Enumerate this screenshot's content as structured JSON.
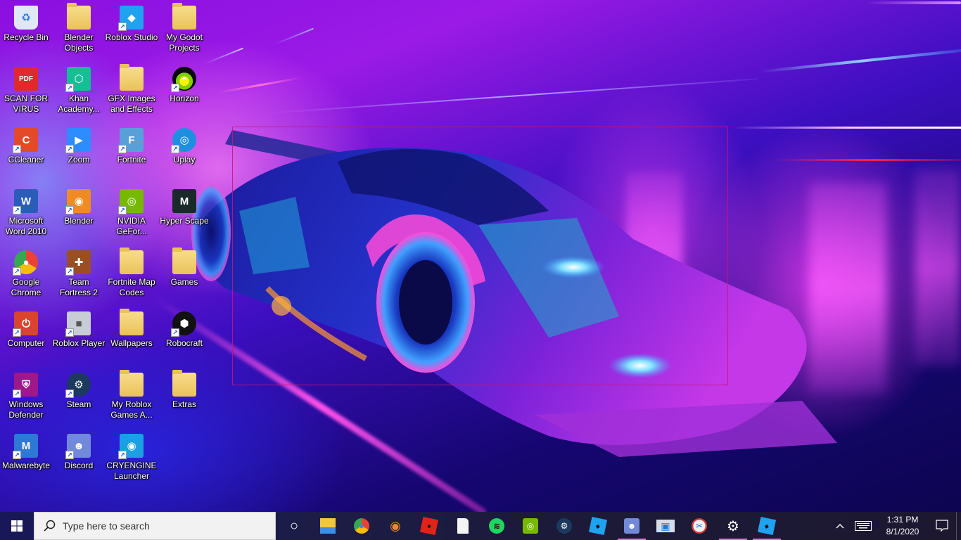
{
  "desktop": {
    "wallpaper": "neon sports car racing wallpaper",
    "selection_rect_color": "#c81478",
    "icons": [
      {
        "label": "Recycle Bin",
        "icon": "recycle-bin-icon",
        "shortcut": false,
        "color": "#dfe8f5"
      },
      {
        "label": "SCAN FOR VIRUS",
        "icon": "pdf-icon",
        "shortcut": false,
        "color": "#e02a2a"
      },
      {
        "label": "CCleaner",
        "icon": "ccleaner-icon",
        "shortcut": true,
        "color": "#e24a2a"
      },
      {
        "label": "Microsoft Word 2010",
        "icon": "word-icon",
        "shortcut": true,
        "color": "#2b5cb8"
      },
      {
        "label": "Google Chrome",
        "icon": "chrome-icon",
        "shortcut": true,
        "color": "#4285f4"
      },
      {
        "label": "Computer",
        "icon": "power-icon",
        "shortcut": true,
        "color": "#d9442f"
      },
      {
        "label": "Windows Defender",
        "icon": "defender-shield-icon",
        "shortcut": true,
        "color": "#a0178a"
      },
      {
        "label": "Malwarebyte",
        "icon": "malwarebytes-icon",
        "shortcut": true,
        "color": "#2f78d6"
      },
      {
        "label": "Blender Objects",
        "icon": "folder-icon",
        "shortcut": false,
        "color": "#eac25a"
      },
      {
        "label": "Khan Academy...",
        "icon": "khan-academy-icon",
        "shortcut": true,
        "color": "#14bf96"
      },
      {
        "label": "Zoom",
        "icon": "zoom-icon",
        "shortcut": true,
        "color": "#2d8cff"
      },
      {
        "label": "Blender",
        "icon": "blender-icon",
        "shortcut": true,
        "color": "#f08a24"
      },
      {
        "label": "Team Fortress 2",
        "icon": "tf2-icon",
        "shortcut": true,
        "color": "#9a4e22"
      },
      {
        "label": "Roblox Player",
        "icon": "roblox-icon",
        "shortcut": true,
        "color": "#c8ccd4"
      },
      {
        "label": "Steam",
        "icon": "steam-icon",
        "shortcut": true,
        "color": "#1b3a5e"
      },
      {
        "label": "Discord",
        "icon": "discord-icon",
        "shortcut": true,
        "color": "#7289da"
      },
      {
        "label": "Roblox Studio",
        "icon": "roblox-studio-icon",
        "shortcut": true,
        "color": "#1fa3f0"
      },
      {
        "label": "GFX Images and Effects",
        "icon": "folder-icon",
        "shortcut": false,
        "color": "#eac25a"
      },
      {
        "label": "Fortnite",
        "icon": "fortnite-icon",
        "shortcut": true,
        "color": "#5aa0d8"
      },
      {
        "label": "NVIDIA GeFor...",
        "icon": "nvidia-icon",
        "shortcut": true,
        "color": "#76b900"
      },
      {
        "label": "Fortnite Map Codes",
        "icon": "folder-icon",
        "shortcut": false,
        "color": "#eac25a"
      },
      {
        "label": "Wallpapers",
        "icon": "folder-icon",
        "shortcut": false,
        "color": "#eac25a"
      },
      {
        "label": "My Roblox Games A...",
        "icon": "folder-icon",
        "shortcut": false,
        "color": "#eac25a"
      },
      {
        "label": "CRYENGINE Launcher",
        "icon": "cryengine-icon",
        "shortcut": true,
        "color": "#1ba1e2"
      },
      {
        "label": "My Godot Projects",
        "icon": "folder-icon",
        "shortcut": false,
        "color": "#eac25a"
      },
      {
        "label": "Horizon",
        "icon": "horizon-icon",
        "shortcut": true,
        "color": "#0a0a0a"
      },
      {
        "label": "Uplay",
        "icon": "uplay-icon",
        "shortcut": true,
        "color": "#1e8fe0"
      },
      {
        "label": "Hyper Scape",
        "icon": "hyper-scape-icon",
        "shortcut": false,
        "color": "#1a2a2a"
      },
      {
        "label": "Games",
        "icon": "folder-icon",
        "shortcut": false,
        "color": "#eac25a"
      },
      {
        "label": "Robocraft",
        "icon": "robocraft-icon",
        "shortcut": true,
        "color": "#111111"
      },
      {
        "label": "Extras",
        "icon": "folder-icon",
        "shortcut": false,
        "color": "#eac25a"
      }
    ]
  },
  "taskbar": {
    "search_placeholder": "Type here to search",
    "pinned": [
      {
        "name": "cortana",
        "icon": "cortana-circle-icon",
        "running": false,
        "color": "#ffffff"
      },
      {
        "name": "file-explorer",
        "icon": "file-explorer-icon",
        "running": false,
        "color": "#f5c542"
      },
      {
        "name": "chrome",
        "icon": "chrome-icon",
        "running": false,
        "color": "#4285f4"
      },
      {
        "name": "blender",
        "icon": "blender-icon",
        "running": false,
        "color": "#f08a24"
      },
      {
        "name": "roblox",
        "icon": "roblox-icon",
        "running": false,
        "color": "#e2231a"
      },
      {
        "name": "blank-file",
        "icon": "blank-file-icon",
        "running": false,
        "color": "#f5f5f5"
      },
      {
        "name": "spotify",
        "icon": "spotify-icon",
        "running": false,
        "color": "#1ed760"
      },
      {
        "name": "nvidia",
        "icon": "nvidia-icon",
        "running": false,
        "color": "#76b900"
      },
      {
        "name": "steam",
        "icon": "steam-icon",
        "running": false,
        "color": "#1b3a5e"
      },
      {
        "name": "roblox-studio",
        "icon": "roblox-studio-icon",
        "running": false,
        "color": "#1fa3f0"
      },
      {
        "name": "discord",
        "icon": "discord-icon",
        "running": true,
        "color": "#7289da"
      },
      {
        "name": "window-app",
        "icon": "window-app-icon",
        "running": false,
        "color": "#1a78d8"
      },
      {
        "name": "snipping-tool",
        "icon": "snipping-tool-icon",
        "running": false,
        "color": "#d43a3a"
      },
      {
        "name": "settings",
        "icon": "gear-icon",
        "running": true,
        "color": "#ffffff"
      },
      {
        "name": "roblox-studio-2",
        "icon": "roblox-studio-icon",
        "running": true,
        "color": "#1fa3f0"
      }
    ],
    "running_indicator_color": "#e86fe0",
    "tray": {
      "time": "1:31 PM",
      "date": "8/1/2020"
    }
  }
}
